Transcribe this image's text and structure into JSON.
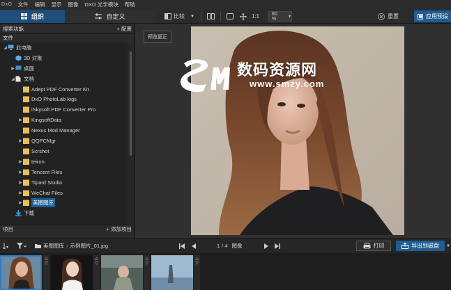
{
  "app": {
    "logo": "DxO"
  },
  "menu": [
    "文件",
    "编辑",
    "显示",
    "图像",
    "DXO 光学模块",
    "帮助"
  ],
  "tabs": {
    "organize": "组织",
    "customize": "自定义"
  },
  "toolbar": {
    "compare": "比较",
    "ratio": "1:1",
    "zoom_value": "80 %",
    "reset": "重置",
    "export_presets": "应用预设"
  },
  "left_panel": {
    "search_label": "搜索功能",
    "config_label": "+ 配置",
    "files_label": "文件",
    "projects_label": "项目",
    "add_project": "+ 添加项目",
    "tree": [
      {
        "label": "此电脑",
        "icon": "computer-icon",
        "depth": 0,
        "expander": "open"
      },
      {
        "label": "3D 对象",
        "icon": "cube-3d-icon",
        "depth": 1,
        "expander": "none"
      },
      {
        "label": "桌面",
        "icon": "desktop-icon",
        "depth": 1,
        "expander": "closed"
      },
      {
        "label": "文档",
        "icon": "documents-icon",
        "depth": 1,
        "expander": "open"
      },
      {
        "label": "Adept PDF Converter Kit",
        "icon": "folder-icon",
        "depth": 2,
        "expander": "none"
      },
      {
        "label": "DxO PhotoLab logs",
        "icon": "folder-icon",
        "depth": 2,
        "expander": "none"
      },
      {
        "label": "iSkysoft PDF Converter Pro",
        "icon": "folder-icon",
        "depth": 2,
        "expander": "none"
      },
      {
        "label": "KingsoftData",
        "icon": "folder-icon",
        "depth": 2,
        "expander": "closed"
      },
      {
        "label": "Nexus Mod Manager",
        "icon": "folder-icon",
        "depth": 2,
        "expander": "none"
      },
      {
        "label": "QQPCMgr",
        "icon": "folder-icon",
        "depth": 2,
        "expander": "closed"
      },
      {
        "label": "Scrshot",
        "icon": "folder-icon",
        "depth": 2,
        "expander": "none"
      },
      {
        "label": "teiron",
        "icon": "folder-icon",
        "depth": 2,
        "expander": "closed"
      },
      {
        "label": "Tencent Files",
        "icon": "folder-icon",
        "depth": 2,
        "expander": "closed"
      },
      {
        "label": "Tipard Studio",
        "icon": "folder-icon",
        "depth": 2,
        "expander": "closed"
      },
      {
        "label": "WeChat Files",
        "icon": "folder-icon",
        "depth": 2,
        "expander": "closed"
      },
      {
        "label": "美图图库",
        "icon": "folder-icon",
        "depth": 2,
        "expander": "closed",
        "selected": true
      },
      {
        "label": "下载",
        "icon": "download-icon",
        "depth": 1,
        "expander": "none"
      }
    ]
  },
  "viewer": {
    "preview_badge": "预览更正",
    "watermark_title": "数码资源网",
    "watermark_url": "www.smzy.com"
  },
  "nav": {
    "breadcrumb_folder": "美图图库",
    "breadcrumb_sep": "›",
    "breadcrumb_file": "示例图片_01.jpg",
    "page_current": "1",
    "page_total": "/ 4",
    "page_unit": "图像",
    "print": "打印",
    "export_disk": "导出到磁盘"
  },
  "filmstrip": {
    "count": 4,
    "selected_index": 0
  },
  "colors": {
    "accent_blue": "#1e5c91",
    "selection_blue": "#1f5f97",
    "folder_yellow": "#e9c153"
  }
}
